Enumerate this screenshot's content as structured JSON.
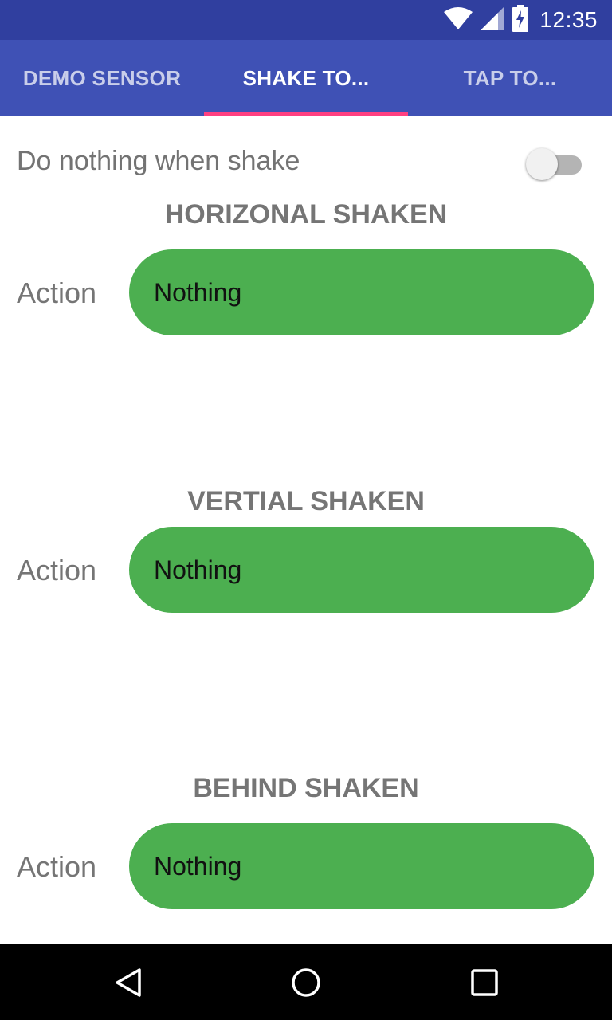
{
  "status_bar": {
    "time": "12:35",
    "icons": [
      "wifi-icon",
      "cell-signal-icon",
      "battery-charging-icon"
    ]
  },
  "tabs": [
    {
      "label": "DEMO SENSOR",
      "active": false
    },
    {
      "label": "SHAKE TO...",
      "active": true
    },
    {
      "label": "TAP TO...",
      "active": false
    }
  ],
  "toggle": {
    "label": "Do nothing when shake",
    "checked": false
  },
  "sections": [
    {
      "title": "HORIZONAL SHAKEN",
      "action_label": "Action",
      "value": "Nothing"
    },
    {
      "title": "VERTIAL SHAKEN",
      "action_label": "Action",
      "value": "Nothing"
    },
    {
      "title": "BEHIND SHAKEN",
      "action_label": "Action",
      "value": "Nothing"
    }
  ],
  "nav_bar": {
    "icons": [
      "back-icon",
      "home-icon",
      "recents-icon"
    ]
  },
  "colors": {
    "status_bar": "#303f9f",
    "tab_bar": "#3f51b5",
    "tab_indicator": "#ff4081",
    "action_pill": "#4caf50"
  }
}
